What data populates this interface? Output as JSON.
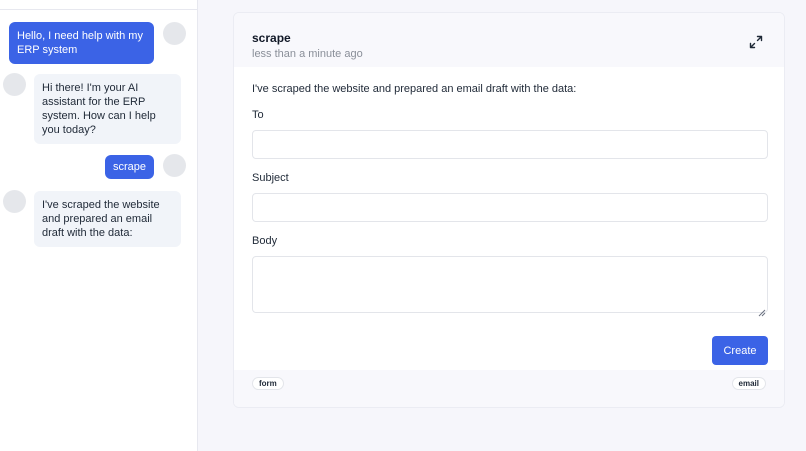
{
  "chat": {
    "messages": [
      {
        "role": "user",
        "text": "Hello, I need help with my ERP system"
      },
      {
        "role": "assistant",
        "text": "Hi there! I'm your AI assistant for the ERP system. How can I help you today?"
      },
      {
        "role": "user",
        "text": "scrape"
      },
      {
        "role": "assistant",
        "text": "I've scraped the website and prepared an email draft with the data:"
      }
    ]
  },
  "card": {
    "title": "scrape",
    "subtitle": "less than a minute ago",
    "intro": "I've scraped the website and prepared an email draft with the data:",
    "fields": {
      "to_label": "To",
      "to_value": "",
      "subject_label": "Subject",
      "subject_value": "",
      "body_label": "Body",
      "body_value": ""
    },
    "create_label": "Create",
    "tags": [
      "form",
      "email"
    ]
  },
  "colors": {
    "accent": "#3b63e6",
    "assistant_bubble": "#f1f4f9",
    "avatar": "#e5e7eb",
    "page_bg": "#f6f6fb"
  },
  "icons": {
    "expand": "expand-arrows-icon"
  }
}
